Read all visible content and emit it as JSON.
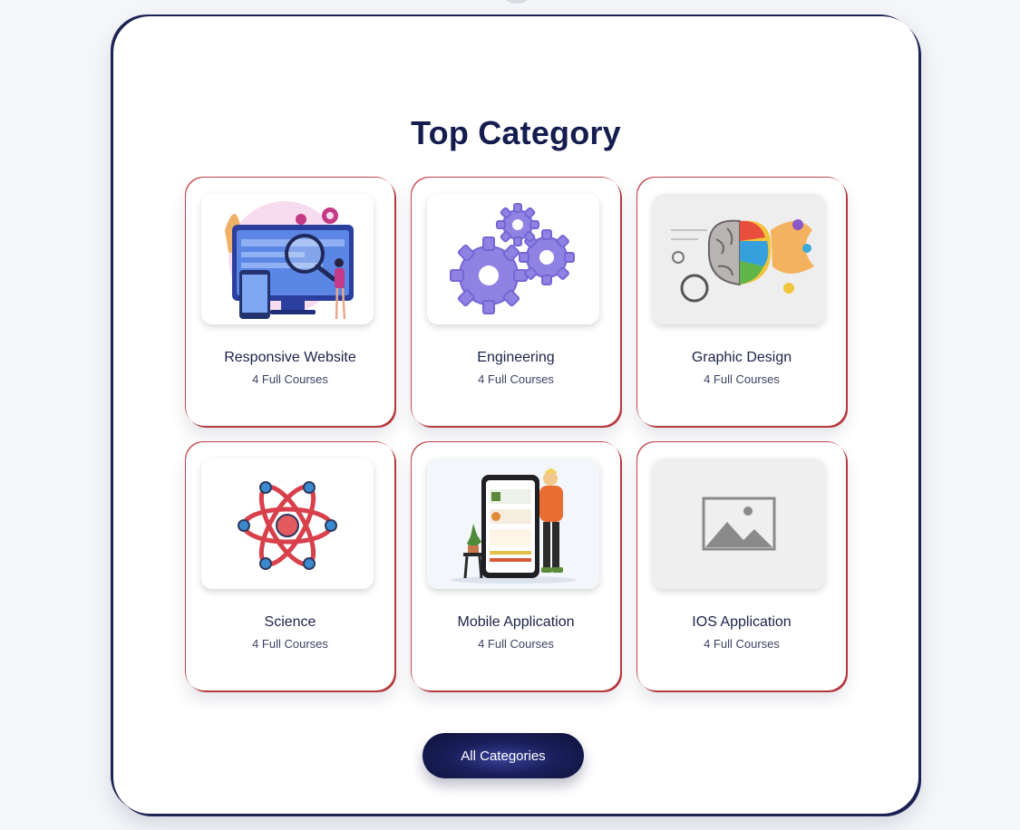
{
  "section": {
    "title": "Top Category",
    "button_label": "All Categories"
  },
  "categories": [
    {
      "name": "Responsive Website",
      "count": "4 Full Courses",
      "icon": "responsive-website-illustration"
    },
    {
      "name": "Engineering",
      "count": "4 Full Courses",
      "icon": "gears-icon"
    },
    {
      "name": "Graphic Design",
      "count": "4 Full Courses",
      "icon": "brain-art-illustration"
    },
    {
      "name": "Science",
      "count": "4 Full Courses",
      "icon": "atom-icon"
    },
    {
      "name": "Mobile Application",
      "count": "4 Full Courses",
      "icon": "mobile-app-illustration"
    },
    {
      "name": "IOS Application",
      "count": "4 Full Courses",
      "icon": "image-placeholder-icon"
    }
  ],
  "colors": {
    "title": "#151d4f",
    "frame_border": "#1c2252",
    "card_border": "#c2434a",
    "button_bg": "#1a1f5c"
  }
}
